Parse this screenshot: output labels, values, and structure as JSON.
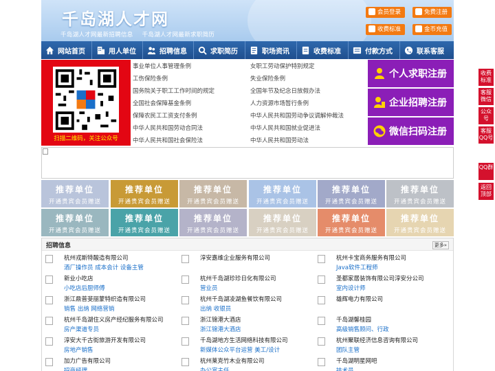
{
  "header": {
    "site_title": "千岛湖人才网",
    "sub_links": [
      "千岛湖人才网最新招聘信息",
      "千岛湖人才网最新求职简历"
    ],
    "buttons": {
      "login": "会员登录",
      "register": "免费注册",
      "fees": "收费标准",
      "recharge": "金币充值"
    }
  },
  "nav": [
    "网站首页",
    "用人单位",
    "招聘信息",
    "求职简历",
    "职场资讯",
    "收费标准",
    "付款方式",
    "联系客服"
  ],
  "qr": {
    "caption": "扫描二维码，关注公众号"
  },
  "links": {
    "left": [
      "事业单位人事管理条例",
      "工伤保险条例",
      "国务院关于职工工作时间的规定",
      "全国社会保障基金条例",
      "保障农民工工资支付条例",
      "中华人民共和国劳动合同法",
      "中华人民共和国社会保险法"
    ],
    "right": [
      "女职工劳动保护特别规定",
      "失业保险条例",
      "全国年节及纪念日放假办法",
      "人力资源市场暂行条例",
      "中华人民共和国劳动争议调解仲裁法",
      "中华人民共和国就业促进法",
      "中华人民共和国劳动法"
    ]
  },
  "register": {
    "seeker": "个人求职注册",
    "company": "企业招聘注册",
    "wechat": "微信扫码注册"
  },
  "recommend": {
    "line1": "推荐单位",
    "line2": "开通贵宾会员赠送"
  },
  "jobs": {
    "title": "招聘信息",
    "more": "更多»",
    "items": [
      {
        "company": "杭州戎斯特酸造有限公司",
        "positions": "酒厂操作员 成本会计 设备主管"
      },
      {
        "company": "淳安嘉维企业服务有限公司",
        "positions": ""
      },
      {
        "company": "杭州卡宝商务服务有限公司",
        "positions": "Java软件工程师"
      },
      {
        "company": "新业小吃店",
        "positions": "小吃店后厨师傅"
      },
      {
        "company": "杭州千岛湖珍珍日化有限公司",
        "positions": "营业员"
      },
      {
        "company": "圣都家居装饰有限公司淳安分公司",
        "positions": "室内设计师"
      },
      {
        "company": "浙江鼎普斐丽蒙特织造有限公司",
        "positions": "销售 出纳 网络营销"
      },
      {
        "company": "杭州千岛湖凌湖鱼餐饮有限公司",
        "positions": "出纳 收银员"
      },
      {
        "company": "雄辉电力有限公司",
        "positions": ""
      },
      {
        "company": "杭州千岛湖住义房产经纪服务有限公司",
        "positions": "房产渠道专员"
      },
      {
        "company": "浙江锦港大酒店",
        "positions": "浙江锦港大酒店"
      },
      {
        "company": "千岛湖馨桂园",
        "positions": "高级销售顾问、行政"
      },
      {
        "company": "淳安大千古街旅游开发有限公司",
        "positions": "房地产销售"
      },
      {
        "company": "千岛湖地方生活网络科技有限公司",
        "positions": "新媒体公众平台运营 美工/设计"
      },
      {
        "company": "杭州聚联经济信息咨询有限公司",
        "positions": "团队主管"
      },
      {
        "company": "加力广告有限公司",
        "positions": "招商经理"
      },
      {
        "company": "杭州莱克竹木业有限公司",
        "positions": "办公室主任"
      },
      {
        "company": "千岛湖明星网吧",
        "positions": "技术员"
      }
    ]
  },
  "side": [
    "收费标准",
    "客服微信",
    "公众号",
    "客服QQ号",
    "QQ群",
    "返回顶部"
  ],
  "colors": {
    "nav": "#2a5fa3",
    "orange": "#f37a12",
    "purple": "#8b1eb7",
    "red": "#e30613",
    "link": "#1a6fc9"
  }
}
